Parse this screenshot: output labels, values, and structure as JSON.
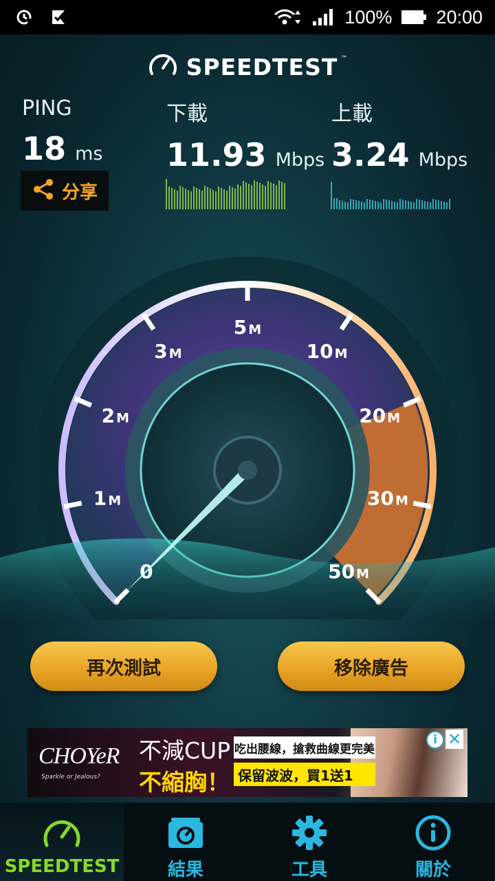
{
  "status_bar": {
    "battery": "100%",
    "time": "20:00",
    "icons": [
      "sync-icon",
      "checklist-icon",
      "wifi-icon",
      "signal-icon",
      "battery-icon"
    ]
  },
  "header": {
    "title": "SPEEDTEST",
    "trademark": "™"
  },
  "metrics": {
    "ping": {
      "label": "PING",
      "value": "18",
      "unit": "ms"
    },
    "download": {
      "label": "下載",
      "value": "11.93",
      "unit": "Mbps"
    },
    "upload": {
      "label": "上載",
      "value": "3.24",
      "unit": "Mbps"
    }
  },
  "share": {
    "label": "分享"
  },
  "gauge": {
    "ticks": [
      "0",
      "1M",
      "2M",
      "3M",
      "5M",
      "10M",
      "20M",
      "30M",
      "50M"
    ],
    "needle_value_mbps": 0
  },
  "buttons": {
    "retest": "再次測試",
    "remove_ads": "移除廣告"
  },
  "ad": {
    "brand": "CHOYeR",
    "brand_sub": "Sparkle or Jealous?",
    "line1": "不減CUP",
    "line2": "不縮胸！",
    "box1": "吃出腰線，搶救曲線更完美",
    "box2": "保留波波，買1送1",
    "info": "i",
    "close": "✕"
  },
  "nav": {
    "items": [
      {
        "label": "SPEEDTEST",
        "icon": "speedometer-icon",
        "active": true
      },
      {
        "label": "結果",
        "icon": "results-icon",
        "active": false
      },
      {
        "label": "工具",
        "icon": "gear-icon",
        "active": false
      },
      {
        "label": "關於",
        "icon": "info-icon",
        "active": false
      }
    ]
  },
  "colors": {
    "accent_orange": "#f6a623",
    "button_gold": "#eab02e",
    "nav_blue": "#2ab7e0",
    "nav_active_green": "#86d92a",
    "gauge_purple": "#6a55b8"
  }
}
